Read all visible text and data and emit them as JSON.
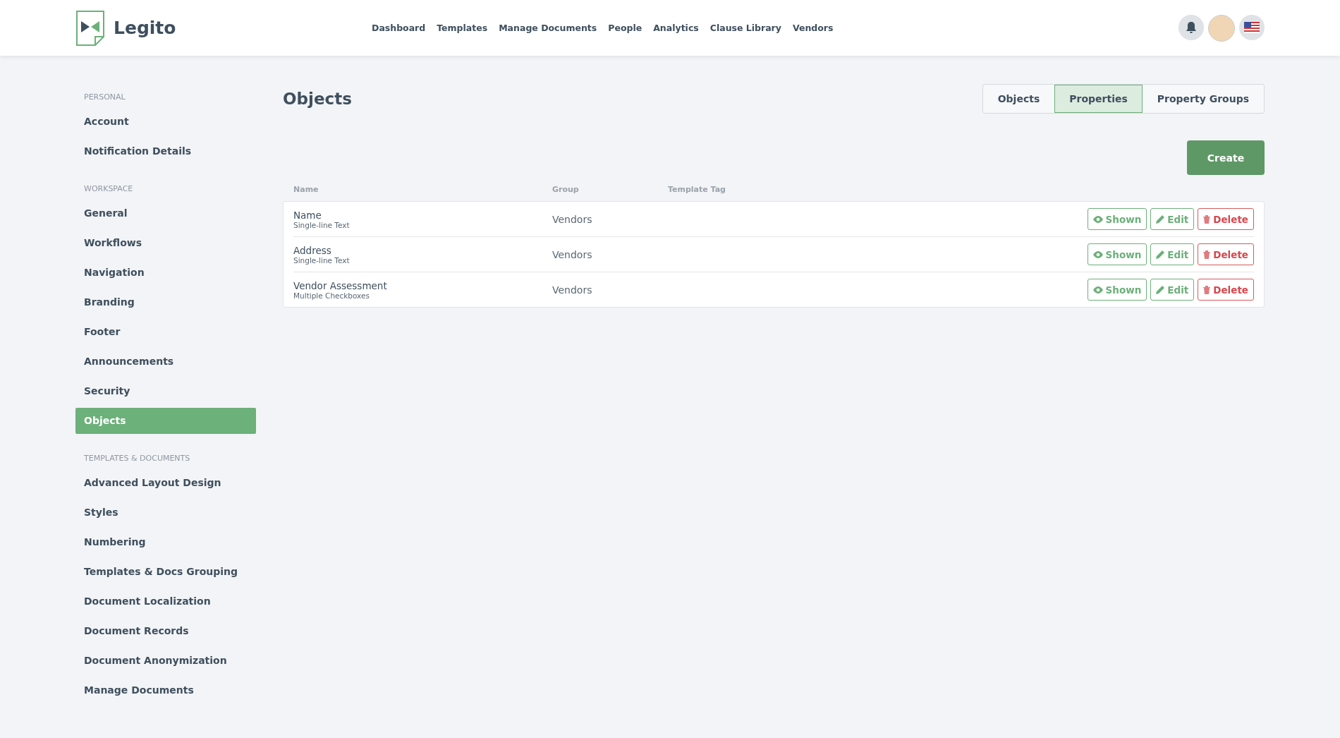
{
  "header": {
    "logo_text": "Legito",
    "nav": [
      {
        "label": "Dashboard"
      },
      {
        "label": "Templates"
      },
      {
        "label": "Manage Documents"
      },
      {
        "label": "People"
      },
      {
        "label": "Analytics"
      },
      {
        "label": "Clause Library"
      },
      {
        "label": "Vendors"
      }
    ]
  },
  "sidebar": {
    "sections": [
      {
        "title": "PERSONAL",
        "items": [
          {
            "label": "Account",
            "selected": false
          },
          {
            "label": "Notification Details",
            "selected": false
          }
        ]
      },
      {
        "title": "WORKSPACE",
        "items": [
          {
            "label": "General",
            "selected": false
          },
          {
            "label": "Workflows",
            "selected": false
          },
          {
            "label": "Navigation",
            "selected": false
          },
          {
            "label": "Branding",
            "selected": false
          },
          {
            "label": "Footer",
            "selected": false
          },
          {
            "label": "Announcements",
            "selected": false
          },
          {
            "label": "Security",
            "selected": false
          },
          {
            "label": "Objects",
            "selected": true
          }
        ]
      },
      {
        "title": "TEMPLATES & DOCUMENTS",
        "items": [
          {
            "label": "Advanced Layout Design",
            "selected": false
          },
          {
            "label": "Styles",
            "selected": false
          },
          {
            "label": "Numbering",
            "selected": false
          },
          {
            "label": "Templates & Docs Grouping",
            "selected": false
          },
          {
            "label": "Document Localization",
            "selected": false
          },
          {
            "label": "Document Records",
            "selected": false
          },
          {
            "label": "Document Anonymization",
            "selected": false
          },
          {
            "label": "Manage Documents",
            "selected": false
          }
        ]
      }
    ]
  },
  "page": {
    "title": "Objects",
    "tabs": [
      {
        "label": "Objects",
        "selected": false
      },
      {
        "label": "Properties",
        "selected": true
      },
      {
        "label": "Property Groups",
        "selected": false
      }
    ],
    "create_button": "Create",
    "table": {
      "columns": [
        "Name",
        "Group",
        "Template Tag"
      ],
      "rows": [
        {
          "name": "Name",
          "type": "Single-line Text",
          "group": "Vendors",
          "shown": "Shown",
          "edit": "Edit",
          "delete": "Delete"
        },
        {
          "name": "Address",
          "type": "Single-line Text",
          "group": "Vendors",
          "shown": "Shown",
          "edit": "Edit",
          "delete": "Delete"
        },
        {
          "name": "Vendor Assessment",
          "type": "Multiple Checkboxes",
          "group": "Vendors",
          "shown": "Shown",
          "edit": "Edit",
          "delete": "Delete"
        }
      ]
    }
  }
}
